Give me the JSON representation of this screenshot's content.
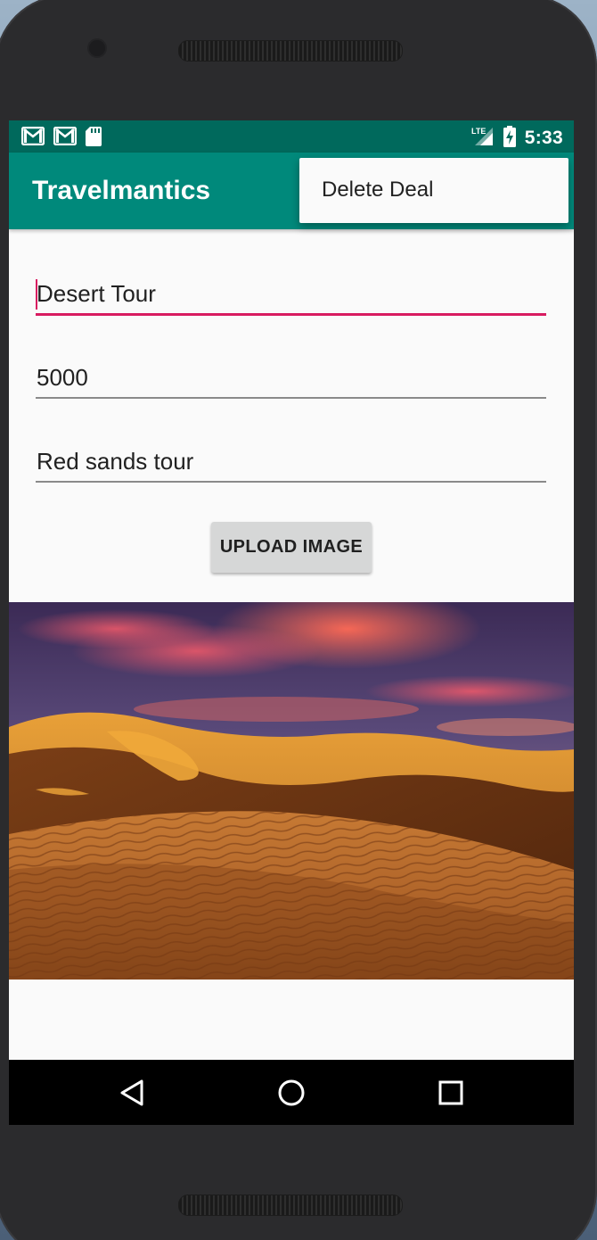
{
  "status_bar": {
    "time": "5:33",
    "network": "LTE",
    "icons_left": [
      "gmail-icon",
      "gmail-icon",
      "sd-card-icon"
    ],
    "icons_right": [
      "lte-signal-icon",
      "battery-charging-icon"
    ]
  },
  "app_bar": {
    "title": "Travelmantics"
  },
  "overflow_menu": {
    "items": [
      {
        "label": "Delete Deal"
      }
    ]
  },
  "form": {
    "title_value": "Desert Tour",
    "price_value": "5000",
    "description_value": "Red sands tour",
    "upload_button_label": "UPLOAD IMAGE"
  },
  "nav_bar": {
    "buttons": [
      "back-icon",
      "home-icon",
      "recents-icon"
    ]
  },
  "colors": {
    "status_bar": "#00695c",
    "app_bar": "#00897b",
    "accent": "#d81b60",
    "background": "#fafafa"
  }
}
